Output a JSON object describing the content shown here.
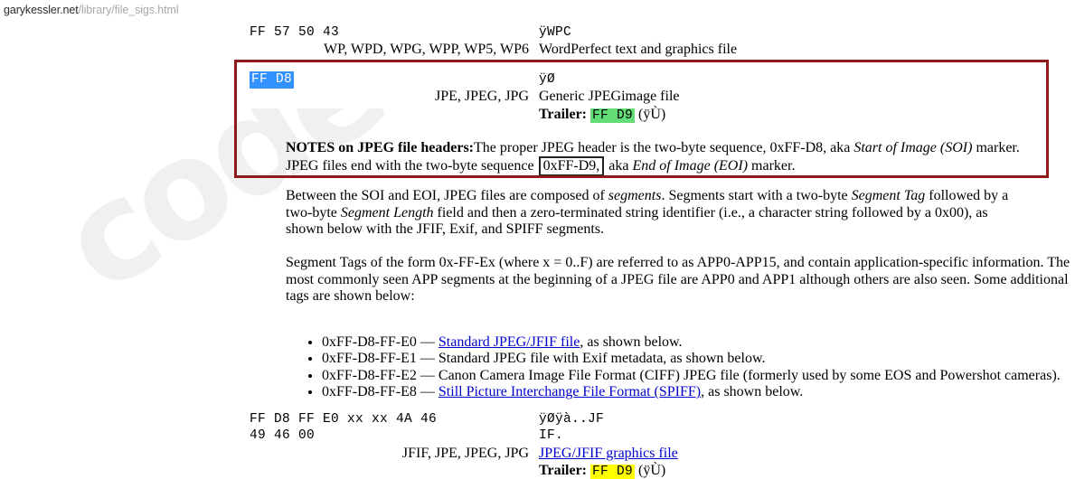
{
  "browser": {
    "url_host": "garykessler.net",
    "url_path": "/library/file_sigs.html"
  },
  "watermark": {
    "text": "codebs.net"
  },
  "annotations": {
    "red_box_label": "red-highlight-box-jpeg-signature",
    "black_box_text": "0xFF-D9,",
    "red_underline_text": "End of Image (EOI)"
  },
  "colors": {
    "selection_blue": "#3392ff",
    "trailer_green": "#64dd78",
    "trailer_yellow": "#ffff00",
    "annotation_red": "#8e1b1b",
    "underline_red": "#c0201f",
    "link_blue": "#0000cc"
  },
  "rows": {
    "wordperfect": {
      "hex": "FF 57 50 43",
      "extensions": "WP, WPD, WPG, WPP, WP5, WP6",
      "ascii": "ÿWPC",
      "description": "WordPerfect text and graphics file"
    },
    "jpeg_generic": {
      "hex": "FF D8",
      "extensions": "JPE, JPEG, JPG",
      "ascii": "ÿØ",
      "description": "Generic JPEGimage file",
      "trailer_label": "Trailer:",
      "trailer_hex": "FF D9",
      "trailer_ascii": "(ÿÙ)"
    },
    "jfif": {
      "hex_line1": "FF D8 FF E0 xx xx 4A 46",
      "hex_line2": "49 46 00",
      "ascii_line1": "ÿØÿà..JF",
      "ascii_line2": "IF.",
      "extensions": "JFIF, JPE, JPEG, JPG",
      "description_link": "JPEG/JFIF graphics file",
      "trailer_label": "Trailer:",
      "trailer_hex": "FF D9",
      "trailer_ascii": "(ÿÙ)"
    }
  },
  "notes": {
    "heading": "NOTES on JPEG file headers:",
    "line1_a": "The proper JPEG header is the two-byte sequence, 0xFF-D8, aka ",
    "line1_italic": "Start of Image (SOI)",
    "line1_b": " marker.",
    "line2_a": "JPEG files end with the two-byte sequence",
    "line2_boxed": "0xFF-D9,",
    "line2_b": "aka ",
    "line2_italic": "End of Image (EOI)",
    "line2_c": " marker."
  },
  "paragraphs": {
    "segments": {
      "a": "Between the SOI and EOI, JPEG files are composed of ",
      "i1": "segments",
      "b": ". Segments start with a two-byte ",
      "i2": "Segment Tag",
      "c": " followed by a two-byte ",
      "i3": "Segment Length",
      "d": " field and then a zero-terminated string identifier (i.e., a character string followed by a 0x00), as shown below with the JFIF, Exif, and SPIFF segments."
    },
    "segment_tags": {
      "text": "Segment Tags of the form 0x-FF-Ex (where x = 0..F) are referred to as APP0-APP15, and contain application-specific information. The most commonly seen APP segments at the beginning of a JPEG file are APP0 and APP1 although others are also seen. Some additional tags are shown below:"
    }
  },
  "bullets": [
    {
      "prefix": "0xFF-D8-FF-E0 — ",
      "link": "Standard JPEG/JFIF file",
      "suffix": ", as shown below.",
      "has_link": true
    },
    {
      "prefix": "0xFF-D8-FF-E1 — Standard JPEG file with Exif metadata, as shown below.",
      "link": "",
      "suffix": "",
      "has_link": false
    },
    {
      "prefix": "0xFF-D8-FF-E2 — Canon Camera Image File Format (CIFF) JPEG file (formerly used by some EOS and Powershot cameras).",
      "link": "",
      "suffix": "",
      "has_link": false
    },
    {
      "prefix": "0xFF-D8-FF-E8 — ",
      "link": "Still Picture Interchange File Format (SPIFF)",
      "suffix": ", as shown below.",
      "has_link": true
    }
  ]
}
